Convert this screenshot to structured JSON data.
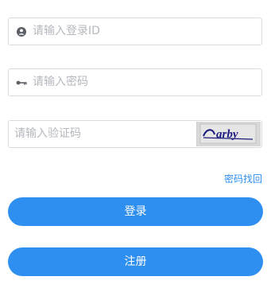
{
  "login_form": {
    "user_id_placeholder": "请输入登录ID",
    "password_placeholder": "请输入密码",
    "captcha_placeholder": "请输入验证码",
    "captcha_image_text": "arby",
    "forgot_password_link": "密码找回",
    "login_button": "登录",
    "register_button": "注册"
  },
  "icons": {
    "user": "user-circle-icon",
    "key": "key-icon"
  },
  "colors": {
    "primary": "#2f8ff0",
    "placeholder": "#b4b8be",
    "border": "#d7dbe0"
  }
}
